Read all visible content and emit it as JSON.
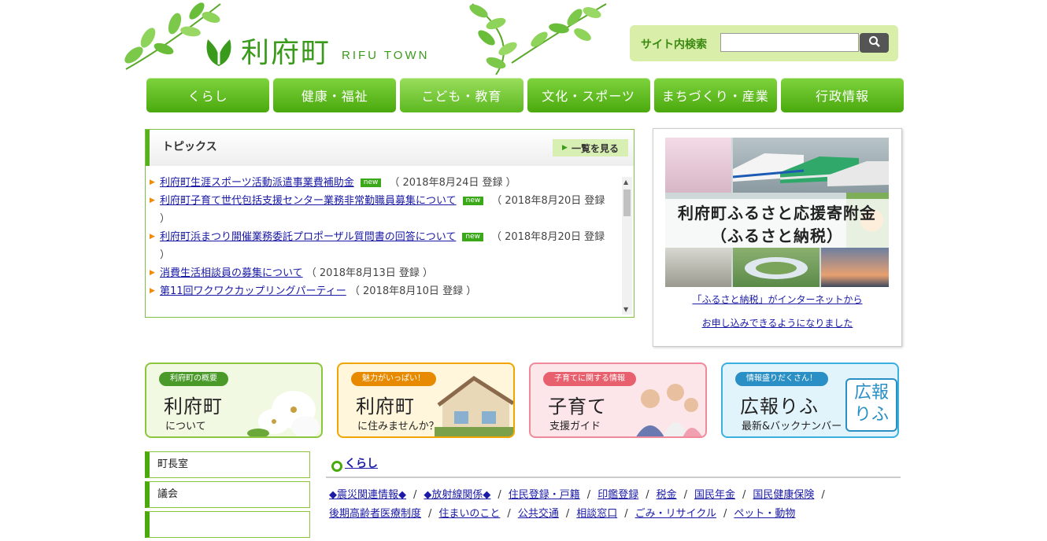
{
  "header": {
    "logo_jp": "利府町",
    "logo_en": "RIFU TOWN",
    "search_label": "サイト内検索",
    "search_value": ""
  },
  "gnav": [
    "くらし",
    "健康・福祉",
    "こども・教育",
    "文化・スポーツ",
    "まちづくり・産業",
    "行政情報"
  ],
  "topics": {
    "title": "トピックス",
    "more": "一覧を見る",
    "new_badge": "new",
    "items": [
      {
        "link": "利府町生涯スポーツ活動派遣事業費補助金",
        "new": true,
        "date": "（ 2018年8月24日 登録 ）"
      },
      {
        "link": "利府町子育て世代包括支援センター業務非常勤職員募集について",
        "new": true,
        "date": "（ 2018年8月20日 登録 ）"
      },
      {
        "link": "利府町浜まつり開催業務委託プロポーザル質問書の回答について",
        "new": true,
        "date": "（ 2018年8月20日 登録 ）"
      },
      {
        "link": "消費生活相談員の募集について",
        "new": false,
        "date": "（ 2018年8月13日 登録 ）"
      },
      {
        "link": "第11回ワクワクカップリングパーティー",
        "new": false,
        "date": "（ 2018年8月10日 登録 ）"
      }
    ]
  },
  "furusato": {
    "title_line1": "利府町ふるさと応援寄附金",
    "title_line2": "（ふるさと納税）",
    "link_line1": "「ふるさと納税」がインターネットから",
    "link_line2": "お申し込みできるようになりました"
  },
  "banners": [
    {
      "tag": "利府町の概要",
      "main": "利府町",
      "sub": "について"
    },
    {
      "tag": "魅力がいっぱい！",
      "main": "利府町",
      "sub": "に住みませんか？"
    },
    {
      "tag": "子育てに関する情報",
      "main": "子育て",
      "sub": "支援ガイド"
    },
    {
      "tag": "情報盛りだくさん！",
      "main": "広報りふ",
      "sub": "最新&バックナンバー",
      "logo": "広報りふ"
    }
  ],
  "side_nav": [
    "町長室",
    "議会"
  ],
  "kurashi": {
    "title": "くらし",
    "links": [
      "◆震災関連情報◆",
      "◆放射線関係◆",
      "住民登録・戸籍",
      "印鑑登録",
      "税金",
      "国民年金",
      "国民健康保険",
      "後期高齢者医療制度",
      "住まいのこと",
      "公共交通",
      "相談窓口",
      "ごみ・リサイクル",
      "ペット・動物"
    ]
  },
  "colors": {
    "brand_green": "#4aa90d",
    "link": "#1a1aa6"
  }
}
